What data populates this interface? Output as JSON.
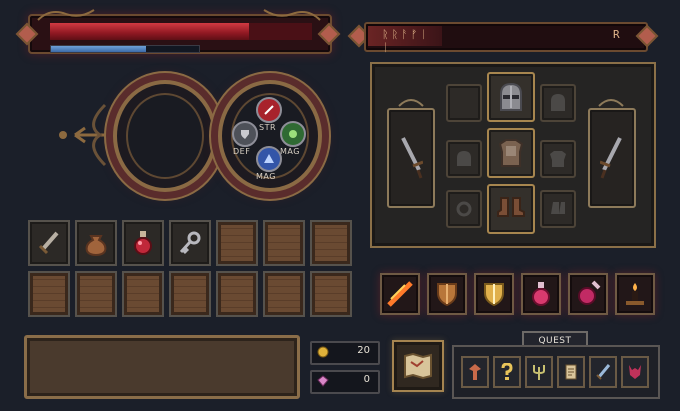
{
  "hud": {
    "health": {
      "fill": 0.76
    },
    "mana": {
      "fill": 0.64
    },
    "rune_bar": {
      "text": "ᚱᚱᚨᚠᛁ ᛁ",
      "end_glyph": "R",
      "fill": 0.27
    }
  },
  "stat_wheel": {
    "stats": [
      {
        "label": "STR",
        "color": "#c0323a"
      },
      {
        "label": "DEF",
        "color": "#5b5e66"
      },
      {
        "label": "MAG",
        "color": "#3c7a3c"
      },
      {
        "label": "MAG",
        "color": "#3f63b8"
      }
    ]
  },
  "equipment": {
    "slots": [
      "helmet",
      "chest-armor",
      "boots",
      "left-weapon",
      "right-weapon"
    ]
  },
  "inventory": {
    "items": [
      "sword",
      "pouch",
      "red-potion",
      "key"
    ],
    "empty_slots": 10
  },
  "skills": [
    "fire-slash",
    "shield-flame",
    "golden-shield",
    "health-potion",
    "mana-potion",
    "candle-altar"
  ],
  "currency": {
    "gold": "20",
    "gems": "0",
    "gold_color": "#e0b23a",
    "gem_color": "#d987c8"
  },
  "quest": {
    "tab_label": "QUEST",
    "icons": [
      "totem-icon",
      "question-icon",
      "trident-icon",
      "scroll-icon",
      "sword-icon",
      "demon-icon"
    ]
  }
}
